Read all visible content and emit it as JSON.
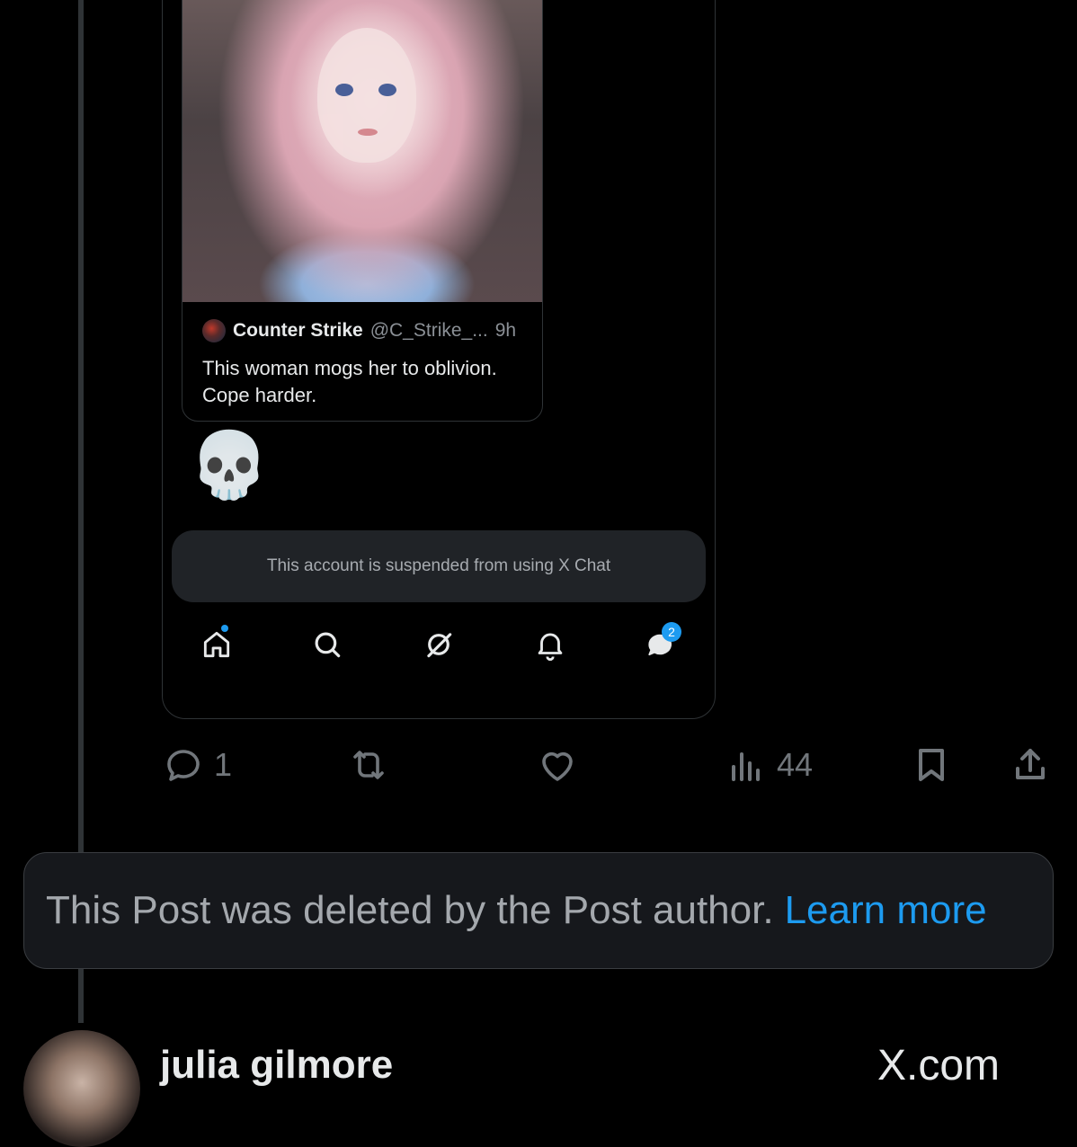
{
  "quoted_post": {
    "author_name": "Counter Strike",
    "author_handle": "@C_Strike_...",
    "time": "9h",
    "text": "This woman mogs her to oblivion. Cope harder."
  },
  "reply_emoji": "💀",
  "chat_notice": "This account is suspended from using X Chat",
  "bottom_nav": {
    "items": [
      "home",
      "search",
      "grok",
      "notifications",
      "messages"
    ],
    "messages_badge": "2"
  },
  "actions": {
    "reply_count": "1",
    "views_count": "44"
  },
  "deleted_notice": {
    "text": "This Post was deleted by the Post author.",
    "link": "Learn more"
  },
  "next_post": {
    "author_name": "julia gilmore",
    "source": "X.com"
  },
  "colors": {
    "background": "#000000",
    "accent": "#1d9bf0",
    "muted": "#71767b"
  }
}
